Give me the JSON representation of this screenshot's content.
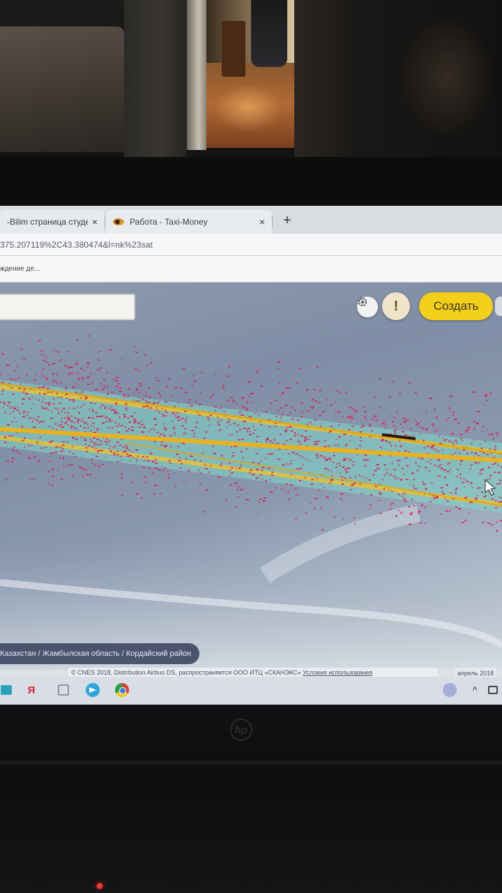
{
  "browser": {
    "tabs": [
      {
        "label": "-Bilim страница студе",
        "active": false
      },
      {
        "label": "Работа - Taxi-Money",
        "active": true
      }
    ],
    "close_glyph": "×",
    "new_tab_glyph": "+",
    "address": "375.207119%2C43.380474&l=nk%23sat",
    "bookmark": "ждение де..."
  },
  "map": {
    "create_button": "Создать",
    "alert_button": "!",
    "breadcrumb": "Казахстан / Жамбылская область / Кордайский район",
    "attribution": "© CNES 2018, Distribution Airbus DS, распространяется ООО ИТЦ «СКАНЭКС»",
    "terms": "Условия использования",
    "imagery_date": "апрель 2018"
  },
  "taskbar": {
    "yandex_glyph": "Я",
    "tray_chevron": "^"
  },
  "icons": {
    "settings": "gear-icon",
    "alert": "exclamation-icon",
    "store": "store-icon",
    "yandex": "yandex-icon",
    "app": "app-window-icon",
    "telegram": "telegram-icon",
    "chrome": "chrome-icon"
  },
  "colors": {
    "create_button": "#f2cf18",
    "road": "#e8b21f",
    "road_buffer": "#7fd9c8",
    "track_points": "#e3174f",
    "map_base": "#8d9bb0"
  }
}
